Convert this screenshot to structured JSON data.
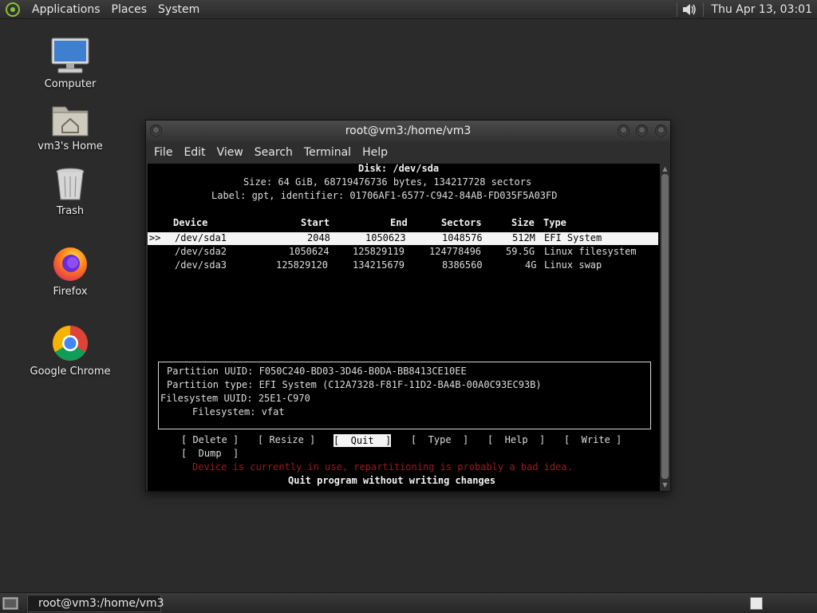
{
  "top_panel": {
    "menus": [
      "Applications",
      "Places",
      "System"
    ],
    "clock": "Thu Apr 13, 03:01"
  },
  "desktop": {
    "icons": [
      {
        "label": "Computer",
        "icon": "computer-icon"
      },
      {
        "label": "vm3's Home",
        "icon": "home-folder-icon"
      },
      {
        "label": "Trash",
        "icon": "trash-icon"
      },
      {
        "label": "Firefox",
        "icon": "firefox-icon"
      },
      {
        "label": "Google Chrome",
        "icon": "chrome-icon"
      }
    ]
  },
  "window": {
    "title": "root@vm3:/home/vm3",
    "menu": [
      "File",
      "Edit",
      "View",
      "Search",
      "Terminal",
      "Help"
    ]
  },
  "cfdisk": {
    "disk_line": "Disk: /dev/sda",
    "size_line": "Size: 64 GiB, 68719476736 bytes, 134217728 sectors",
    "label_line": "Label: gpt, identifier: 01706AF1-6577-C942-84AB-FD035F5A03FD",
    "columns": [
      "Device",
      "Start",
      "End",
      "Sectors",
      "Size",
      "Type"
    ],
    "partitions": [
      {
        "marker": ">>",
        "device": "/dev/sda1",
        "start": "2048",
        "end": "1050623",
        "sectors": "1048576",
        "size": "512M",
        "type": "EFI System",
        "selected": true
      },
      {
        "marker": "",
        "device": "/dev/sda2",
        "start": "1050624",
        "end": "125829119",
        "sectors": "124778496",
        "size": "59.5G",
        "type": "Linux filesystem",
        "selected": false
      },
      {
        "marker": "",
        "device": "/dev/sda3",
        "start": "125829120",
        "end": "134215679",
        "sectors": "8386560",
        "size": "4G",
        "type": "Linux swap",
        "selected": false
      }
    ],
    "info": {
      "partition_uuid": "Partition UUID: F050C240-BD03-3D46-B0DA-BB8413CE10EE",
      "partition_type": "Partition type: EFI System (C12A7328-F81F-11D2-BA4B-00A0C93EC93B)",
      "filesystem_uuid": "Filesystem UUID: 25E1-C970",
      "filesystem": "Filesystem: vfat"
    },
    "actions": [
      {
        "label": "[ Delete ]",
        "selected": false
      },
      {
        "label": "[ Resize ]",
        "selected": false
      },
      {
        "label": "[  Quit  ]",
        "selected": true
      },
      {
        "label": "[  Type  ]",
        "selected": false
      },
      {
        "label": "[  Help  ]",
        "selected": false
      },
      {
        "label": "[  Write ]",
        "selected": false
      },
      {
        "label": "[  Dump  ]",
        "selected": false
      }
    ],
    "warning": "Device is currently in use, repartitioning is probably a bad idea.",
    "hint": "Quit program without writing changes"
  },
  "bottom_panel": {
    "task_label": "root@vm3:/home/vm3"
  }
}
